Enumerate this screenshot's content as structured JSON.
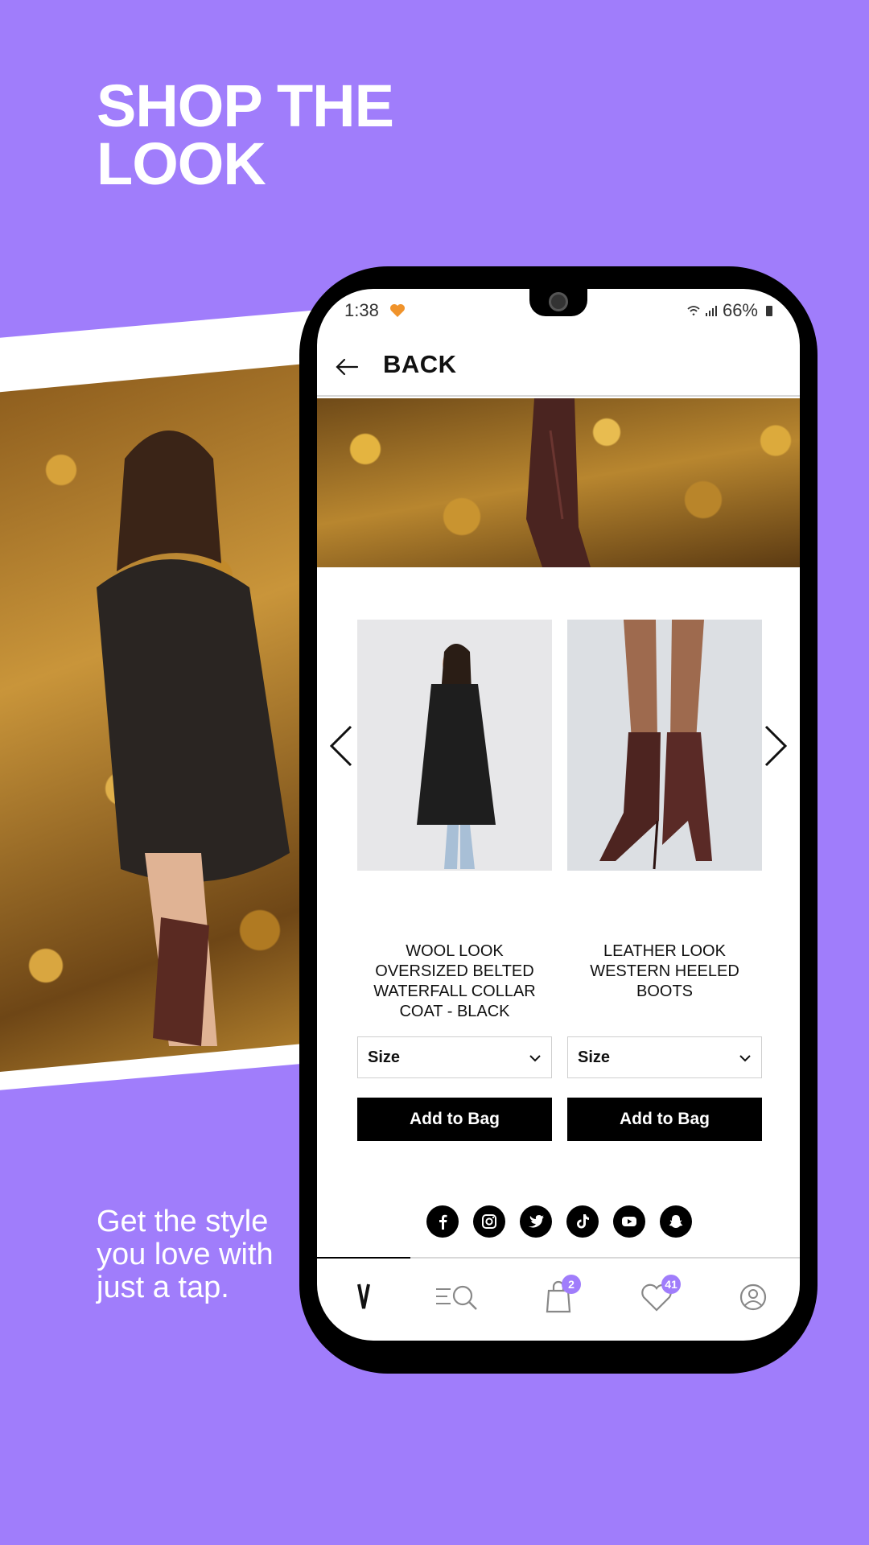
{
  "promo": {
    "headline_line1": "SHOP THE",
    "headline_line2": "LOOK",
    "subline_line1": "Get the style",
    "subline_line2": "you love with",
    "subline_line3": "just a tap."
  },
  "status_bar": {
    "time": "1:38",
    "battery": "66%"
  },
  "header": {
    "back_label": "BACK",
    "back_icon": "arrow-left-icon"
  },
  "products": [
    {
      "name": "WOOL LOOK OVERSIZED BELTED WATERFALL COLLAR COAT - BLACK",
      "size_placeholder": "Size",
      "add_label": "Add to Bag"
    },
    {
      "name": "LEATHER LOOK WESTERN HEELED BOOTS",
      "size_placeholder": "Size",
      "add_label": "Add to Bag"
    }
  ],
  "social": [
    "facebook-icon",
    "instagram-icon",
    "twitter-icon",
    "tiktok-icon",
    "youtube-icon",
    "snapchat-icon"
  ],
  "bottom_nav": {
    "bag_count": "2",
    "wishlist_count": "41"
  },
  "colors": {
    "accent": "#a07dfb",
    "background": "#a07dfb"
  }
}
